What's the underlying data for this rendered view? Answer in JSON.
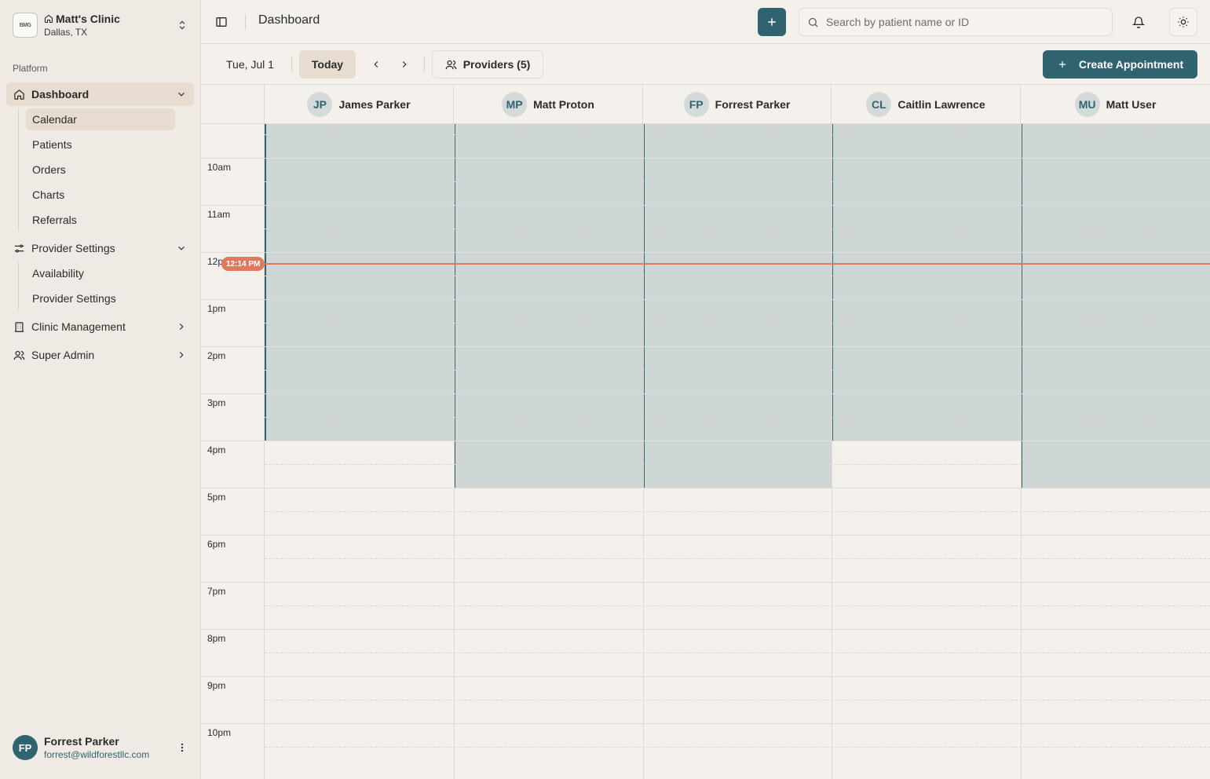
{
  "clinic": {
    "logo_text": "BMG",
    "name": "Matt's Clinic",
    "location": "Dallas, TX"
  },
  "sidebar": {
    "section_label": "Platform",
    "dashboard": {
      "label": "Dashboard",
      "children": [
        "Calendar",
        "Patients",
        "Orders",
        "Charts",
        "Referrals"
      ],
      "active_child": "Calendar"
    },
    "provider_settings": {
      "label": "Provider Settings",
      "children": [
        "Availability",
        "Provider Settings"
      ]
    },
    "clinic_management": {
      "label": "Clinic Management"
    },
    "super_admin": {
      "label": "Super Admin"
    }
  },
  "user": {
    "initials": "FP",
    "name": "Forrest Parker",
    "email": "forrest@wildforestllc.com"
  },
  "topbar": {
    "title": "Dashboard",
    "search_placeholder": "Search by patient name or ID"
  },
  "toolbar": {
    "date": "Tue, Jul 1",
    "today_label": "Today",
    "providers_label": "Providers (5)",
    "create_label": "Create Appointment"
  },
  "providers": [
    {
      "initials": "JP",
      "name": "James Parker"
    },
    {
      "initials": "MP",
      "name": "Matt Proton"
    },
    {
      "initials": "FP",
      "name": "Forrest Parker"
    },
    {
      "initials": "CL",
      "name": "Caitlin Lawrence"
    },
    {
      "initials": "MU",
      "name": "Matt User"
    }
  ],
  "time_labels": [
    "10am",
    "11am",
    "12p",
    "1pm",
    "2pm",
    "3pm",
    "4pm",
    "5pm",
    "6pm",
    "7pm",
    "8pm",
    "9pm",
    "10pm"
  ],
  "current_time": "12:14 PM",
  "colors": {
    "accent": "#2f6370",
    "now": "#e07a5f",
    "active_bg": "#e6dccf"
  }
}
